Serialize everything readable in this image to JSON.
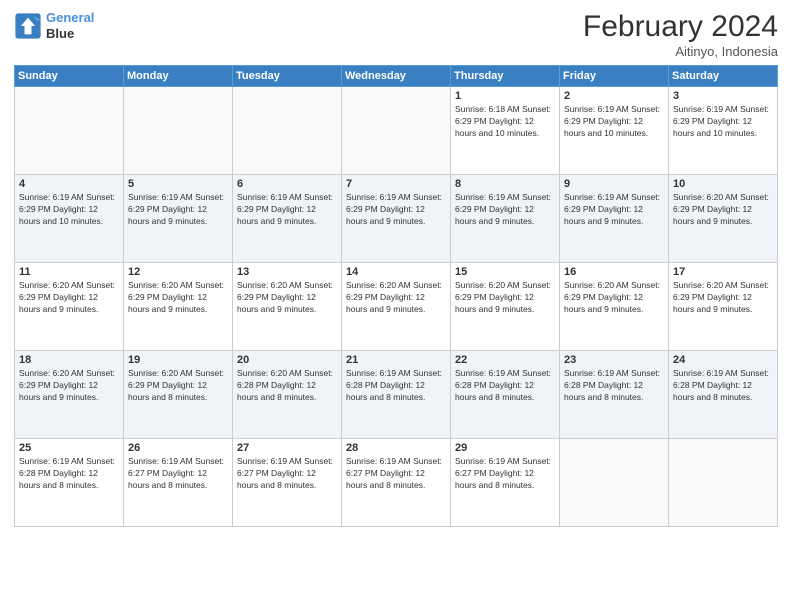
{
  "logo": {
    "line1": "General",
    "line2": "Blue"
  },
  "title": "February 2024",
  "location": "Aitinyo, Indonesia",
  "days_of_week": [
    "Sunday",
    "Monday",
    "Tuesday",
    "Wednesday",
    "Thursday",
    "Friday",
    "Saturday"
  ],
  "weeks": [
    {
      "row_class": "",
      "days": [
        {
          "number": "",
          "info": ""
        },
        {
          "number": "",
          "info": ""
        },
        {
          "number": "",
          "info": ""
        },
        {
          "number": "",
          "info": ""
        },
        {
          "number": "1",
          "info": "Sunrise: 6:18 AM\nSunset: 6:29 PM\nDaylight: 12 hours\nand 10 minutes."
        },
        {
          "number": "2",
          "info": "Sunrise: 6:19 AM\nSunset: 6:29 PM\nDaylight: 12 hours\nand 10 minutes."
        },
        {
          "number": "3",
          "info": "Sunrise: 6:19 AM\nSunset: 6:29 PM\nDaylight: 12 hours\nand 10 minutes."
        }
      ]
    },
    {
      "row_class": "alt-row",
      "days": [
        {
          "number": "4",
          "info": "Sunrise: 6:19 AM\nSunset: 6:29 PM\nDaylight: 12 hours\nand 10 minutes."
        },
        {
          "number": "5",
          "info": "Sunrise: 6:19 AM\nSunset: 6:29 PM\nDaylight: 12 hours\nand 9 minutes."
        },
        {
          "number": "6",
          "info": "Sunrise: 6:19 AM\nSunset: 6:29 PM\nDaylight: 12 hours\nand 9 minutes."
        },
        {
          "number": "7",
          "info": "Sunrise: 6:19 AM\nSunset: 6:29 PM\nDaylight: 12 hours\nand 9 minutes."
        },
        {
          "number": "8",
          "info": "Sunrise: 6:19 AM\nSunset: 6:29 PM\nDaylight: 12 hours\nand 9 minutes."
        },
        {
          "number": "9",
          "info": "Sunrise: 6:19 AM\nSunset: 6:29 PM\nDaylight: 12 hours\nand 9 minutes."
        },
        {
          "number": "10",
          "info": "Sunrise: 6:20 AM\nSunset: 6:29 PM\nDaylight: 12 hours\nand 9 minutes."
        }
      ]
    },
    {
      "row_class": "",
      "days": [
        {
          "number": "11",
          "info": "Sunrise: 6:20 AM\nSunset: 6:29 PM\nDaylight: 12 hours\nand 9 minutes."
        },
        {
          "number": "12",
          "info": "Sunrise: 6:20 AM\nSunset: 6:29 PM\nDaylight: 12 hours\nand 9 minutes."
        },
        {
          "number": "13",
          "info": "Sunrise: 6:20 AM\nSunset: 6:29 PM\nDaylight: 12 hours\nand 9 minutes."
        },
        {
          "number": "14",
          "info": "Sunrise: 6:20 AM\nSunset: 6:29 PM\nDaylight: 12 hours\nand 9 minutes."
        },
        {
          "number": "15",
          "info": "Sunrise: 6:20 AM\nSunset: 6:29 PM\nDaylight: 12 hours\nand 9 minutes."
        },
        {
          "number": "16",
          "info": "Sunrise: 6:20 AM\nSunset: 6:29 PM\nDaylight: 12 hours\nand 9 minutes."
        },
        {
          "number": "17",
          "info": "Sunrise: 6:20 AM\nSunset: 6:29 PM\nDaylight: 12 hours\nand 9 minutes."
        }
      ]
    },
    {
      "row_class": "alt-row",
      "days": [
        {
          "number": "18",
          "info": "Sunrise: 6:20 AM\nSunset: 6:29 PM\nDaylight: 12 hours\nand 9 minutes."
        },
        {
          "number": "19",
          "info": "Sunrise: 6:20 AM\nSunset: 6:29 PM\nDaylight: 12 hours\nand 8 minutes."
        },
        {
          "number": "20",
          "info": "Sunrise: 6:20 AM\nSunset: 6:28 PM\nDaylight: 12 hours\nand 8 minutes."
        },
        {
          "number": "21",
          "info": "Sunrise: 6:19 AM\nSunset: 6:28 PM\nDaylight: 12 hours\nand 8 minutes."
        },
        {
          "number": "22",
          "info": "Sunrise: 6:19 AM\nSunset: 6:28 PM\nDaylight: 12 hours\nand 8 minutes."
        },
        {
          "number": "23",
          "info": "Sunrise: 6:19 AM\nSunset: 6:28 PM\nDaylight: 12 hours\nand 8 minutes."
        },
        {
          "number": "24",
          "info": "Sunrise: 6:19 AM\nSunset: 6:28 PM\nDaylight: 12 hours\nand 8 minutes."
        }
      ]
    },
    {
      "row_class": "",
      "days": [
        {
          "number": "25",
          "info": "Sunrise: 6:19 AM\nSunset: 6:28 PM\nDaylight: 12 hours\nand 8 minutes."
        },
        {
          "number": "26",
          "info": "Sunrise: 6:19 AM\nSunset: 6:27 PM\nDaylight: 12 hours\nand 8 minutes."
        },
        {
          "number": "27",
          "info": "Sunrise: 6:19 AM\nSunset: 6:27 PM\nDaylight: 12 hours\nand 8 minutes."
        },
        {
          "number": "28",
          "info": "Sunrise: 6:19 AM\nSunset: 6:27 PM\nDaylight: 12 hours\nand 8 minutes."
        },
        {
          "number": "29",
          "info": "Sunrise: 6:19 AM\nSunset: 6:27 PM\nDaylight: 12 hours\nand 8 minutes."
        },
        {
          "number": "",
          "info": ""
        },
        {
          "number": "",
          "info": ""
        }
      ]
    }
  ]
}
